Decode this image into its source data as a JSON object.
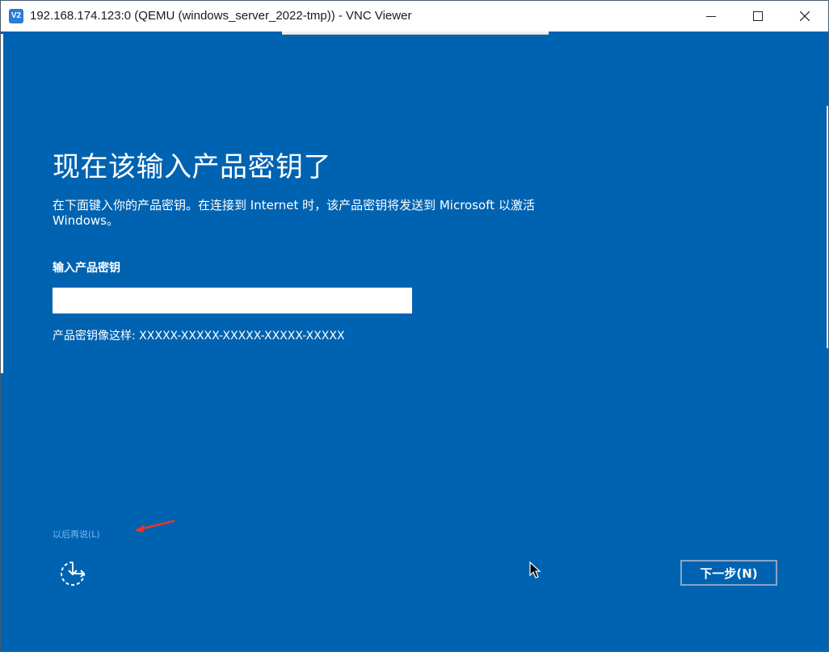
{
  "window": {
    "title": "192.168.174.123:0 (QEMU (windows_server_2022-tmp)) - VNC Viewer",
    "app_icon_text": "V2",
    "background_color": "#0063b1"
  },
  "setup": {
    "heading": "现在该输入产品密钥了",
    "description": "在下面键入你的产品密钥。在连接到 Internet 时，该产品密钥将发送到 Microsoft 以激活 Windows。",
    "field_label": "输入产品密钥",
    "key_value": "",
    "format_hint": "产品密钥像这样: XXXXX-XXXXX-XXXXX-XXXXX-XXXXX",
    "later_link": "以后再说(L)",
    "next_button": "下一步(N)",
    "link_color": "#7ab8f5",
    "annotation_arrow_color": "#e8352b"
  },
  "icons": {
    "accessibility": "ease-of-access-icon",
    "cursor": "mouse-pointer-icon"
  }
}
